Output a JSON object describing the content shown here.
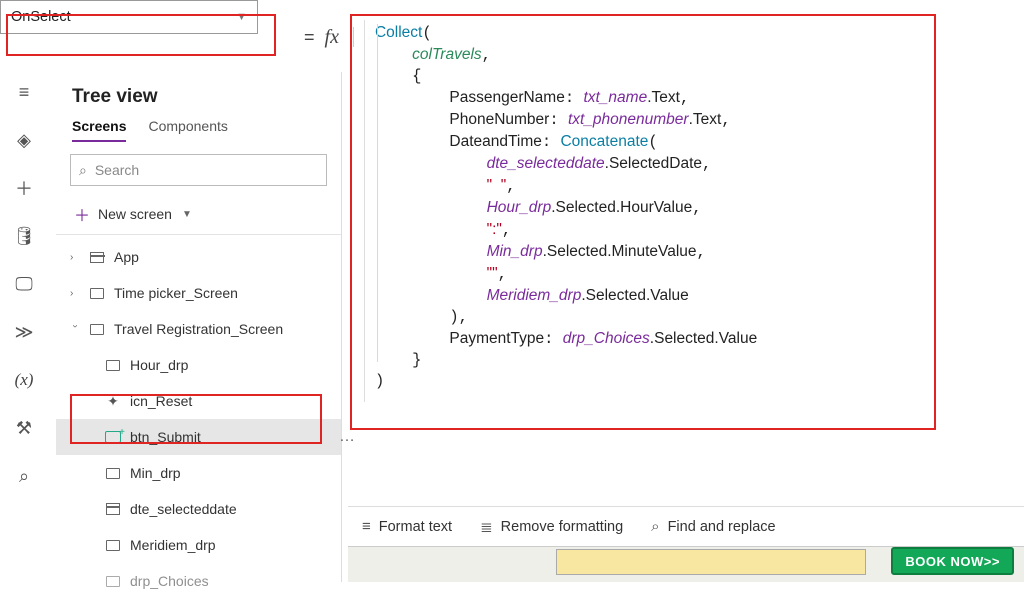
{
  "property_dropdown": {
    "value": "OnSelect"
  },
  "fx_prefix": {
    "equals": "=",
    "fx": "fx"
  },
  "tree": {
    "title": "Tree view",
    "tabs": {
      "screens": "Screens",
      "components": "Components"
    },
    "search_placeholder": "Search",
    "new_screen": "New screen",
    "items": [
      {
        "k": "app",
        "label": "App",
        "kind": "app",
        "depth": 0,
        "expandable": true,
        "expanded": false
      },
      {
        "k": "tps",
        "label": "Time picker_Screen",
        "kind": "screen",
        "depth": 0,
        "expandable": true,
        "expanded": false
      },
      {
        "k": "trs",
        "label": "Travel Registration_Screen",
        "kind": "screen",
        "depth": 0,
        "expandable": true,
        "expanded": true
      },
      {
        "k": "hr",
        "label": "Hour_drp",
        "kind": "dropdown",
        "depth": 1
      },
      {
        "k": "rst",
        "label": "icn_Reset",
        "kind": "icons",
        "depth": 1
      },
      {
        "k": "sub",
        "label": "btn_Submit",
        "kind": "button",
        "depth": 1,
        "selected": true
      },
      {
        "k": "min",
        "label": "Min_drp",
        "kind": "dropdown",
        "depth": 1
      },
      {
        "k": "dte",
        "label": "dte_selecteddate",
        "kind": "date",
        "depth": 1
      },
      {
        "k": "mer",
        "label": "Meridiem_drp",
        "kind": "dropdown",
        "depth": 1
      },
      {
        "k": "chc",
        "label": "drp_Choices",
        "kind": "dropdown",
        "depth": 1
      }
    ]
  },
  "formula": {
    "t": {
      "Collect": "Collect",
      "colTravels": "colTravels",
      "PassengerName": "PassengerName",
      "txt_name": "txt_name",
      "Text": ".Text",
      "PhoneNumber": "PhoneNumber",
      "txt_phonenumber": "txt_phonenumber",
      "DateandTime": "DateandTime",
      "Concatenate": "Concatenate",
      "dte_selecteddate": "dte_selecteddate",
      "SelectedDate": ".SelectedDate",
      "spc": "\"  \"",
      "Hour_drp": "Hour_drp",
      "SelHour": ".Selected.HourValue",
      "colon": "\":\"",
      "Min_drp": "Min_drp",
      "SelMin": ".Selected.MinuteValue",
      "empty": "\"\"",
      "Meridiem_drp": "Meridiem_drp",
      "SelVal": ".Selected.Value",
      "PaymentType": "PaymentType",
      "drp_Choices": "drp_Choices"
    }
  },
  "bottom": {
    "format": "Format text",
    "remove": "Remove formatting",
    "find": "Find and replace"
  },
  "canvas": {
    "book": "BOOK NOW>>"
  }
}
